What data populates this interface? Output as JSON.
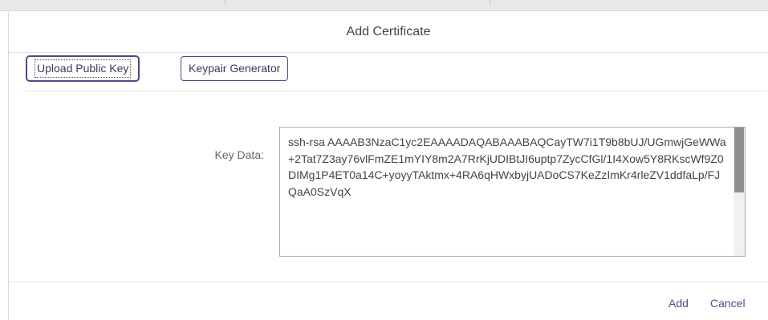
{
  "dialog": {
    "title": "Add Certificate",
    "tabs": [
      {
        "label": "Upload Public Key",
        "active": true
      },
      {
        "label": "Keypair Generator",
        "active": false
      }
    ],
    "key_field": {
      "label": "Key Data:",
      "value": "ssh-rsa AAAAB3NzaC1yc2EAAAADAQABAAABAQCayTW7i1T9b8bUJ/UGmwjGeWWa+2Tat7Z3ay76vlFmZE1mYIY8m2A7RrKjUDIBtJI6uptp7ZycCfGl/1I4Xow5Y8RKscWf9Z0DIMg1P4ET0a14C+yoyyTAktmx+4RA6qHWxbyjUADoCS7KeZzImKr4rleZV1ddfaLp/FJQaA0SzVqX"
    },
    "footer": {
      "add_label": "Add",
      "cancel_label": "Cancel"
    }
  },
  "colors": {
    "accent": "#4a4a86",
    "link": "#4d4d8a",
    "scroll_thumb": "#8f8f8f"
  }
}
